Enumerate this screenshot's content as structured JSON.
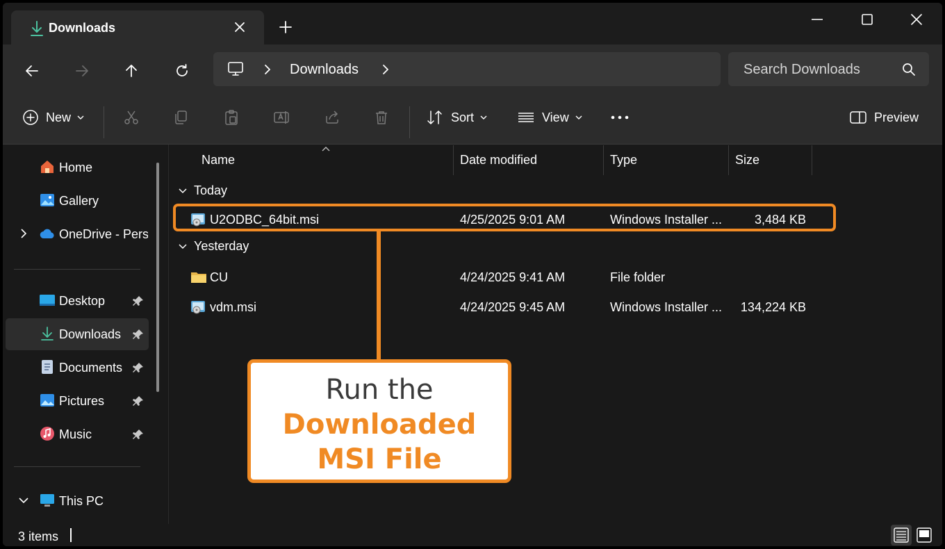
{
  "tab": {
    "title": "Downloads"
  },
  "address": {
    "crumbs": [
      "Downloads"
    ]
  },
  "search": {
    "placeholder": "Search Downloads"
  },
  "commands": {
    "new_label": "New",
    "sort_label": "Sort",
    "view_label": "View",
    "preview_label": "Preview"
  },
  "sidebar": {
    "items": [
      {
        "label": "Home"
      },
      {
        "label": "Gallery"
      },
      {
        "label": "OneDrive - Personal"
      },
      {
        "label": "Desktop"
      },
      {
        "label": "Downloads"
      },
      {
        "label": "Documents"
      },
      {
        "label": "Pictures"
      },
      {
        "label": "Music"
      },
      {
        "label": "This PC"
      }
    ]
  },
  "columns": {
    "name": "Name",
    "date": "Date modified",
    "type": "Type",
    "size": "Size"
  },
  "groups": [
    {
      "label": "Today",
      "files": [
        {
          "name": "U2ODBC_64bit.msi",
          "date": "4/25/2025 9:01 AM",
          "type": "Windows Installer ...",
          "size": "3,484 KB"
        }
      ]
    },
    {
      "label": "Yesterday",
      "files": [
        {
          "name": "CU",
          "date": "4/24/2025 9:41 AM",
          "type": "File folder",
          "size": ""
        },
        {
          "name": "vdm.msi",
          "date": "4/24/2025 9:45 AM",
          "type": "Windows Installer ...",
          "size": "134,224 KB"
        }
      ]
    }
  ],
  "callout": {
    "line1": "Run the",
    "line2": "Downloaded",
    "line3": "MSI File"
  },
  "status": {
    "count": "3 items"
  },
  "colors": {
    "accent": "#f08a24",
    "window": "#191919",
    "toolbar": "#2c2c2c"
  }
}
